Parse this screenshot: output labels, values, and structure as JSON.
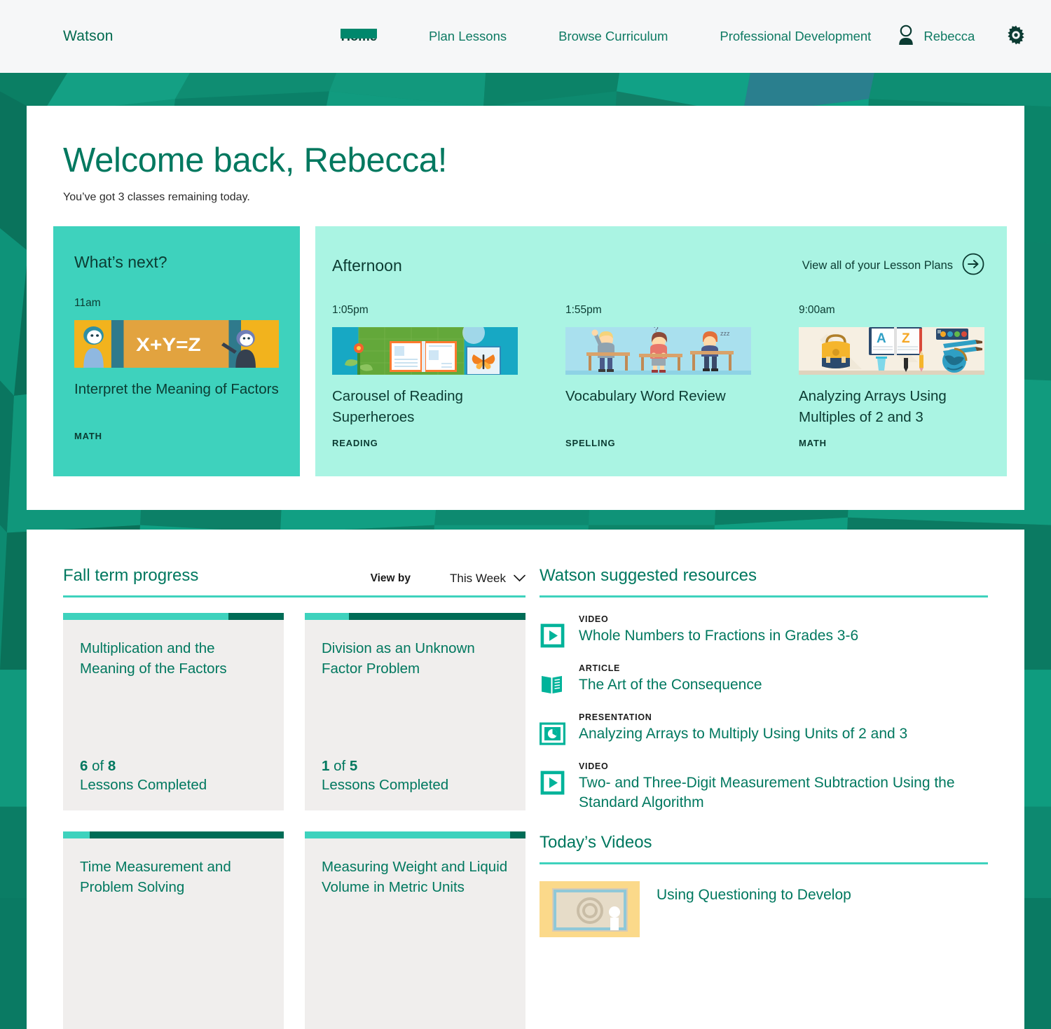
{
  "nav": {
    "brand": "Watson",
    "links": [
      {
        "label": "Home",
        "active": true
      },
      {
        "label": "Plan Lessons",
        "active": false
      },
      {
        "label": "Browse Curriculum",
        "active": false
      },
      {
        "label": "Professional Development",
        "active": false
      }
    ],
    "user_name": "Rebecca",
    "avatar_icon": "user-icon",
    "settings_icon": "gear-icon"
  },
  "welcome": {
    "title": "Welcome back, Rebecca!",
    "subtitle": "You’ve got 3 classes remaining today."
  },
  "whats_next": {
    "heading": "What’s next?",
    "lesson": {
      "time": "11am",
      "title": "Interpret the Meaning of Factors",
      "subject": "MATH",
      "thumb": "math-chalkboard-thumb"
    }
  },
  "afternoon": {
    "heading": "Afternoon",
    "view_all_label": "View all of your Lesson Plans",
    "view_all_icon": "arrow-right-circle-icon",
    "lessons": [
      {
        "time": "1:05pm",
        "title": "Carousel of Reading Superheroes",
        "subject": "READING",
        "thumb": "open-book-thumb"
      },
      {
        "time": "1:55pm",
        "title": "Vocabulary Word Review",
        "subject": "SPELLING",
        "thumb": "students-at-desks-thumb"
      },
      {
        "time": "9:00am",
        "title": "Analyzing Arrays Using Multiples of 2 and 3",
        "subject": "MATH",
        "thumb": "school-supplies-thumb"
      }
    ]
  },
  "progress": {
    "heading": "Fall term progress",
    "view_by_label": "View by",
    "view_by_value": "This Week",
    "view_by_icon": "chevron-down-icon",
    "cards": [
      {
        "name": "Multiplication and the Meaning of the Factors",
        "completed": "6",
        "of": "of",
        "total": "8",
        "completed_label": "Lessons Completed",
        "percent": 75
      },
      {
        "name": "Division as an Unknown Factor Problem",
        "completed": "1",
        "of": "of",
        "total": "5",
        "completed_label": "Lessons Completed",
        "percent": 20
      },
      {
        "name": "Time Measurement and Problem Solving",
        "completed": "",
        "of": "",
        "total": "",
        "completed_label": "",
        "percent": 12
      },
      {
        "name": "Measuring Weight and Liquid Volume in Metric Units",
        "completed": "",
        "of": "",
        "total": "",
        "completed_label": "",
        "percent": 93
      }
    ]
  },
  "resources": {
    "heading": "Watson suggested resources",
    "items": [
      {
        "kind": "VIDEO",
        "icon": "play-video-icon",
        "title": "Whole Numbers to Fractions in Grades 3-6"
      },
      {
        "kind": "ARTICLE",
        "icon": "article-book-icon",
        "title": "The Art of the Consequence"
      },
      {
        "kind": "PRESENTATION",
        "icon": "presentation-chart-icon",
        "title": "Analyzing Arrays to Multiply Using Units of 2 and 3"
      },
      {
        "kind": "VIDEO",
        "icon": "play-video-icon",
        "title": "Two- and Three-Digit Measurement Subtraction Using the Standard Algorithm"
      }
    ]
  },
  "videos": {
    "heading": "Today’s Videos",
    "items": [
      {
        "title": "Using Questioning to Develop",
        "thumb": "questioning-video-thumb"
      }
    ]
  },
  "colors": {
    "brand_green": "#00785f",
    "deep_green": "#006c56",
    "accent_teal": "#3ed2bd",
    "light_teal": "#aaf4e3",
    "nav_bg": "#f6f7f8",
    "card_gray": "#f0eeed",
    "dark_text": "#0b3b32"
  }
}
